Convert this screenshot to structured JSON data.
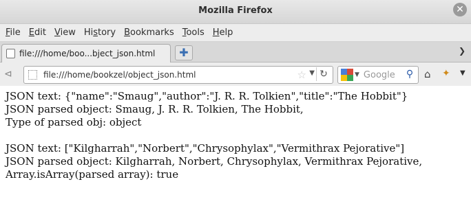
{
  "window": {
    "title": "Mozilla Firefox"
  },
  "menubar": {
    "items": [
      {
        "label": "File",
        "accel": "F",
        "rest": "ile"
      },
      {
        "label": "Edit",
        "accel": "E",
        "rest": "dit"
      },
      {
        "label": "View",
        "accel": "V",
        "rest": "iew"
      },
      {
        "label": "History",
        "accel": "s",
        "pre": "Hi",
        "rest": "tory"
      },
      {
        "label": "Bookmarks",
        "accel": "B",
        "rest": "ookmarks"
      },
      {
        "label": "Tools",
        "accel": "T",
        "rest": "ools"
      },
      {
        "label": "Help",
        "accel": "H",
        "rest": "elp"
      }
    ]
  },
  "tabs": [
    {
      "label": "file:///home/boo...bject_json.html",
      "active": true
    }
  ],
  "navbar": {
    "url": "file:///home/bookzel/object_json.html",
    "search_placeholder": "Google"
  },
  "content": {
    "lines": [
      "JSON text: {\"name\":\"Smaug\",\"author\":\"J. R. R. Tolkien\",\"title\":\"The Hobbit\"}",
      "JSON parsed object: Smaug, J. R. R. Tolkien, The Hobbit,",
      "Type of parsed obj: object",
      "",
      "JSON text: [\"Kilgharrah\",\"Norbert\",\"Chrysophylax\",\"Vermithrax Pejorative\"]",
      "JSON parsed object: Kilgharrah, Norbert, Chrysophylax, Vermithrax Pejorative,",
      "Array.isArray(parsed array): true"
    ]
  },
  "colors": {
    "accent": "#3a6fb3",
    "chrome_bg": "#ededed",
    "content_bg": "#ffffff"
  },
  "icons": [
    "close-icon",
    "new-tab-icon",
    "tab-list-icon",
    "back-icon",
    "page-icon",
    "bookmark-star-icon",
    "dropdown-icon",
    "reload-icon",
    "google-icon",
    "search-icon",
    "home-icon",
    "addon-icon",
    "menu-chevron-icon"
  ]
}
